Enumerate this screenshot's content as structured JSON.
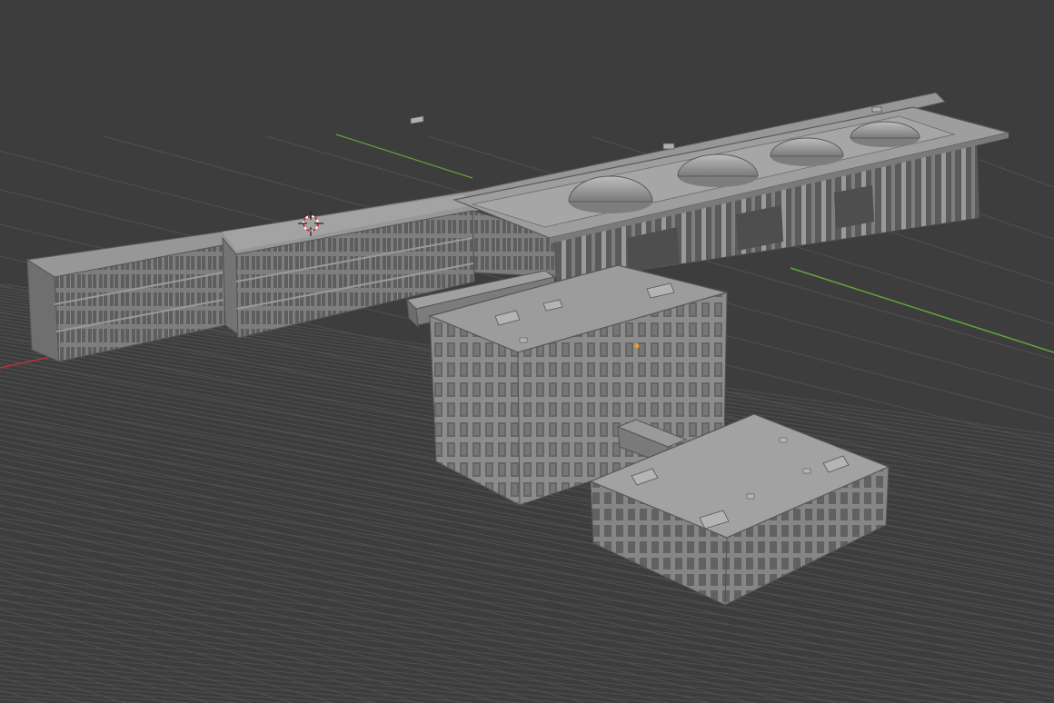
{
  "app": {
    "name": "3D Viewport"
  },
  "viewport": {
    "background": "#3d3d3d",
    "grid_color": "#4f4f4f",
    "axis_x_color": "#b8323c",
    "axis_y_color": "#62a53a",
    "cursor_color": "#d8313a",
    "origin_color": "#f29a29"
  },
  "scene": {
    "model_color": "#8f8f8f",
    "objects": [
      "long-wing-building",
      "domed-hall-building",
      "tall-office-block",
      "low-office-block",
      "connector-bridge"
    ],
    "dome_count": 4
  }
}
